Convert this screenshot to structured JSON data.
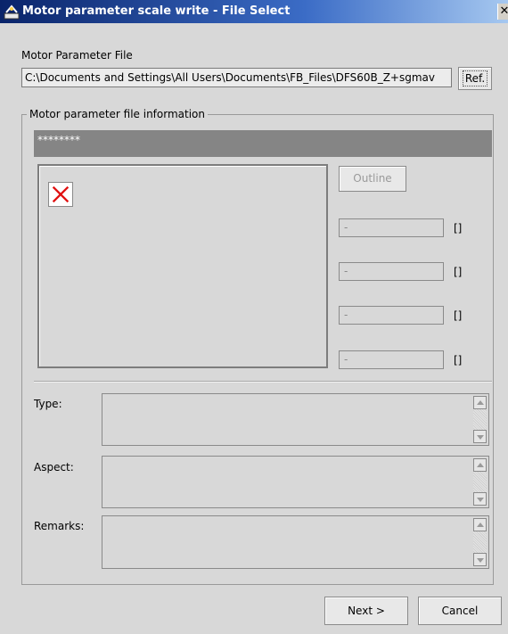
{
  "window": {
    "title": "Motor parameter scale write - File Select",
    "close_glyph": "✕"
  },
  "file": {
    "label": "Motor Parameter File",
    "path": "C:\\Documents and Settings\\All Users\\Documents\\FB_Files\\DFS60B_Z+sgmav",
    "ref_label": "Ref."
  },
  "info": {
    "legend": "Motor parameter file information",
    "name": "********",
    "outline_label": "Outline",
    "values": [
      {
        "value": "-",
        "unit": "[]"
      },
      {
        "value": "-",
        "unit": "[]"
      },
      {
        "value": "-",
        "unit": "[]"
      },
      {
        "value": "-",
        "unit": "[]"
      }
    ],
    "type_label": "Type:",
    "aspect_label": "Aspect:",
    "remarks_label": "Remarks:"
  },
  "footer": {
    "next_label": "Next >",
    "cancel_label": "Cancel"
  },
  "icons": {
    "app": "motor-app-icon",
    "broken_image": "broken-image-icon",
    "scroll_up": "scroll-up-arrow-icon",
    "scroll_down": "scroll-down-arrow-icon"
  },
  "colors": {
    "title_bar": "#0a246a",
    "window_bg": "#d8d8d8",
    "name_bar": "#858585",
    "broken_image_x": "#e01010"
  }
}
